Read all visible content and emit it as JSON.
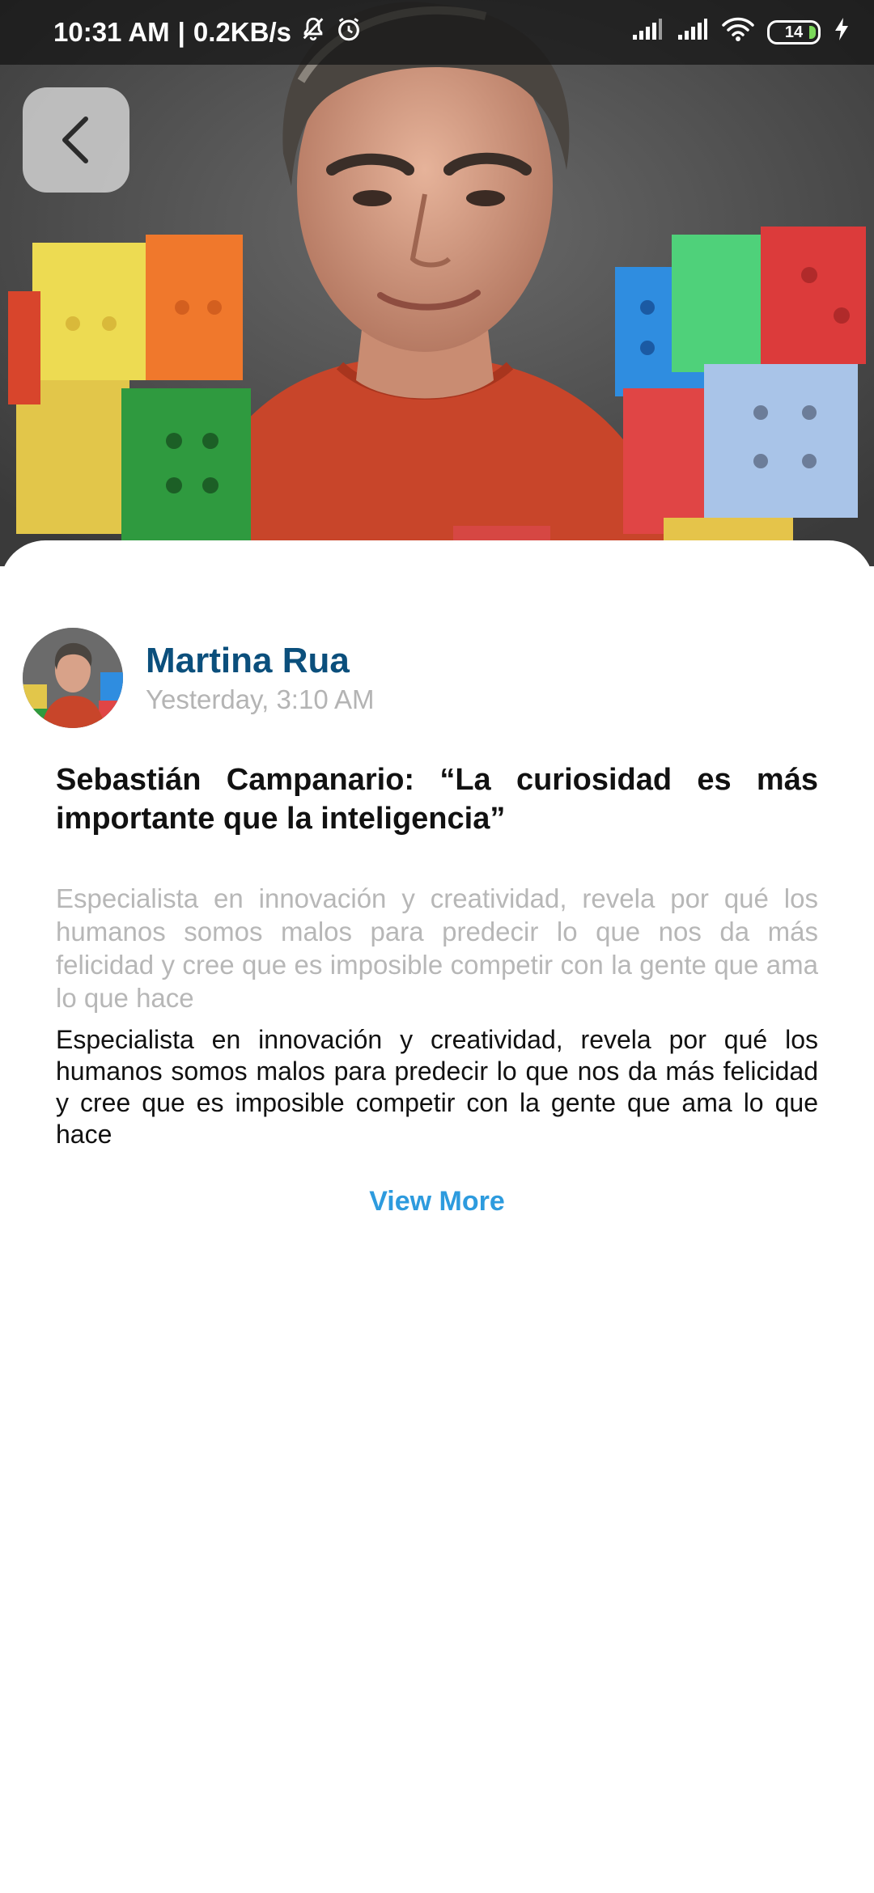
{
  "status_bar": {
    "time": "10:31 AM",
    "separator": "|",
    "network_speed": "0.2KB/s",
    "battery_level": "14",
    "icons": [
      "notifications-off-icon",
      "alarm-icon",
      "signal-icon",
      "signal-icon",
      "wifi-icon",
      "battery-icon",
      "charging-icon"
    ]
  },
  "hero": {
    "image": "article-cover-photo"
  },
  "header": {
    "back_icon": "chevron-left-icon"
  },
  "author": {
    "name": "Martina Rua",
    "timestamp": "Yesterday, 3:10 AM"
  },
  "article": {
    "title": "Sebastián Campanario: “La curiosidad es más importante que la inteligencia”",
    "subtitle": "Especialista en innovación y creatividad, revela por qué los humanos somos malos para predecir lo que nos da más felicidad y cree que es imposible competir con la gente que ama lo que hace",
    "body": "Especialista en innovación y creatividad, revela por qué los humanos somos malos para predecir lo que nos da más felicidad y cree que es imposible competir con la gente que ama lo que hace",
    "view_more_label": "View More"
  },
  "colors": {
    "author_name": "#0b4f7c",
    "link": "#2d9bde",
    "muted_text": "#b4b4b4"
  }
}
